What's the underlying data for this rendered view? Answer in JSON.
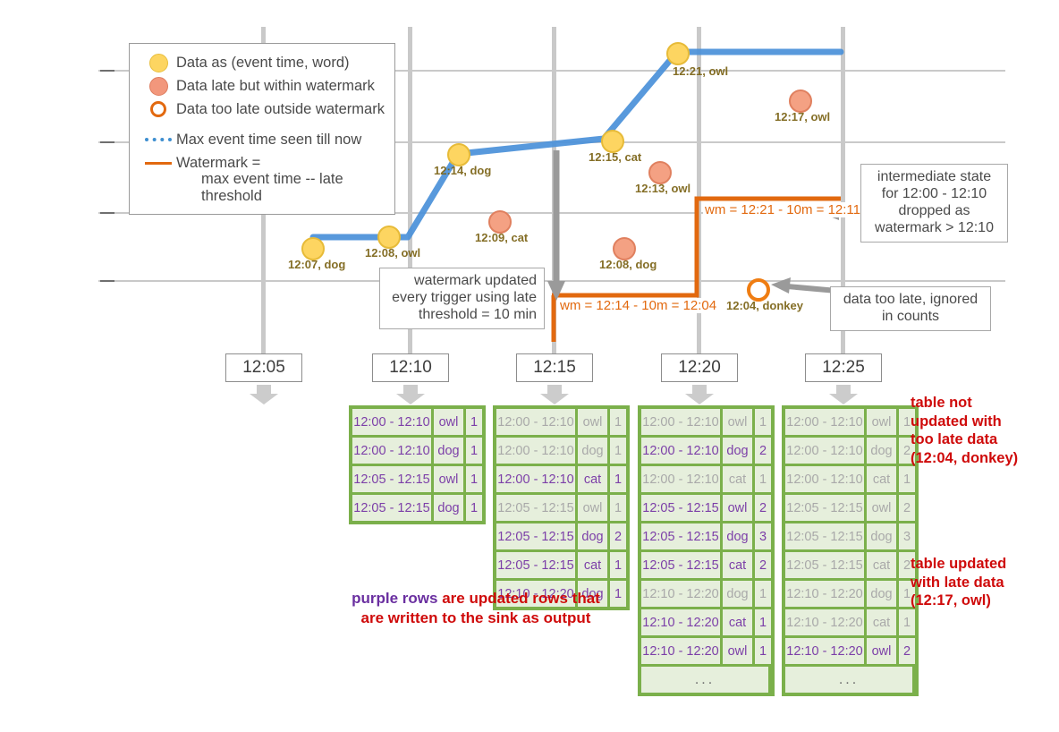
{
  "legend": {
    "items": [
      {
        "marker": "dot-yellow-icon",
        "label": "Data as (event time, word)"
      },
      {
        "marker": "dot-salmon-icon",
        "label": "Data late but within watermark"
      },
      {
        "marker": "ring-orange-icon",
        "label": "Data too late outside watermark"
      },
      {
        "marker": "dotted-blue-line-icon",
        "label": "Max event time seen till now"
      },
      {
        "marker": "solid-orange-line-icon",
        "label": "Watermark ="
      }
    ],
    "watermark_definition": "max event time -- late threshold"
  },
  "data_points": [
    {
      "label": "12:07, dog",
      "type": "yellow"
    },
    {
      "label": "12:08, owl",
      "type": "yellow"
    },
    {
      "label": "12:14, dog",
      "type": "yellow"
    },
    {
      "label": "12:09, cat",
      "type": "salmon"
    },
    {
      "label": "12:15, cat",
      "type": "yellow"
    },
    {
      "label": "12:08, dog",
      "type": "salmon"
    },
    {
      "label": "12:13, owl",
      "type": "salmon"
    },
    {
      "label": "12:21, owl",
      "type": "yellow"
    },
    {
      "label": "12:17, owl",
      "type": "salmon"
    },
    {
      "label": "12:04, donkey",
      "type": "open"
    }
  ],
  "watermark_labels": {
    "lower": "wm = 12:14 - 10m = 12:04",
    "upper": "wm = 12:21 - 10m = 12:11"
  },
  "callouts": {
    "watermark_updated": "watermark updated\nevery trigger using late\nthreshold = 10 min",
    "intermediate_state": "intermediate state\nfor 12:00 - 12:10\ndropped as\nwatermark > 12:10",
    "data_too_late": "data too late,\nignored in counts"
  },
  "time_axis": {
    "ticks": [
      "12:05",
      "12:10",
      "12:15",
      "12:20",
      "12:25"
    ]
  },
  "tables": [
    {
      "trigger": "12:10",
      "rows": [
        {
          "window": "12:00 - 12:10",
          "word": "owl",
          "count": "1",
          "updated": true
        },
        {
          "window": "12:00 - 12:10",
          "word": "dog",
          "count": "1",
          "updated": true
        },
        {
          "window": "12:05 - 12:15",
          "word": "owl",
          "count": "1",
          "updated": true
        },
        {
          "window": "12:05 - 12:15",
          "word": "dog",
          "count": "1",
          "updated": true
        }
      ],
      "ellipsis": false
    },
    {
      "trigger": "12:15",
      "rows": [
        {
          "window": "12:00 - 12:10",
          "word": "owl",
          "count": "1",
          "updated": false
        },
        {
          "window": "12:00 - 12:10",
          "word": "dog",
          "count": "1",
          "updated": false
        },
        {
          "window": "12:00 - 12:10",
          "word": "cat",
          "count": "1",
          "updated": true
        },
        {
          "window": "12:05 - 12:15",
          "word": "owl",
          "count": "1",
          "updated": false
        },
        {
          "window": "12:05 - 12:15",
          "word": "dog",
          "count": "2",
          "updated": true
        },
        {
          "window": "12:05 - 12:15",
          "word": "cat",
          "count": "1",
          "updated": true
        },
        {
          "window": "12:10 - 12:20",
          "word": "dog",
          "count": "1",
          "updated": true
        }
      ],
      "ellipsis": false
    },
    {
      "trigger": "12:20",
      "rows": [
        {
          "window": "12:00 - 12:10",
          "word": "owl",
          "count": "1",
          "updated": false
        },
        {
          "window": "12:00 - 12:10",
          "word": "dog",
          "count": "2",
          "updated": true
        },
        {
          "window": "12:00 - 12:10",
          "word": "cat",
          "count": "1",
          "updated": false
        },
        {
          "window": "12:05 - 12:15",
          "word": "owl",
          "count": "2",
          "updated": true
        },
        {
          "window": "12:05 - 12:15",
          "word": "dog",
          "count": "3",
          "updated": true
        },
        {
          "window": "12:05 - 12:15",
          "word": "cat",
          "count": "2",
          "updated": true
        },
        {
          "window": "12:10 - 12:20",
          "word": "dog",
          "count": "1",
          "updated": false
        },
        {
          "window": "12:10 - 12:20",
          "word": "cat",
          "count": "1",
          "updated": true
        },
        {
          "window": "12:10 - 12:20",
          "word": "owl",
          "count": "1",
          "updated": true
        }
      ],
      "ellipsis": true,
      "ellipsis_text": "..."
    },
    {
      "trigger": "12:25",
      "rows": [
        {
          "window": "12:00 - 12:10",
          "word": "owl",
          "count": "1",
          "updated": false
        },
        {
          "window": "12:00 - 12:10",
          "word": "dog",
          "count": "2",
          "updated": false
        },
        {
          "window": "12:00 - 12:10",
          "word": "cat",
          "count": "1",
          "updated": false
        },
        {
          "window": "12:05 - 12:15",
          "word": "owl",
          "count": "2",
          "updated": false
        },
        {
          "window": "12:05 - 12:15",
          "word": "dog",
          "count": "3",
          "updated": false
        },
        {
          "window": "12:05 - 12:15",
          "word": "cat",
          "count": "2",
          "updated": false
        },
        {
          "window": "12:10 - 12:20",
          "word": "dog",
          "count": "1",
          "updated": false
        },
        {
          "window": "12:10 - 12:20",
          "word": "cat",
          "count": "1",
          "updated": false
        },
        {
          "window": "12:10 - 12:20",
          "word": "owl",
          "count": "2",
          "updated": true
        }
      ],
      "ellipsis": true,
      "ellipsis_text": "..."
    }
  ],
  "annotations": {
    "red_top": "table not\nupdated with\ntoo late data\n(12:04, donkey)",
    "red_bottom": "table updated\nwith late data\n(12:17, owl)",
    "purple_caption_purple": "purple rows",
    "purple_caption_rest_line1": " are updated rows that",
    "purple_caption_line2": "are written to the sink as output"
  },
  "colors": {
    "yellow": "#fdd561",
    "salmon": "#f4a183",
    "orange": "#e2690f",
    "blue": "#3f8fd0",
    "green": "#7bb04b",
    "purple": "#7c3fa8",
    "red": "#cf0a0a",
    "gray": "#c9c9c9"
  }
}
